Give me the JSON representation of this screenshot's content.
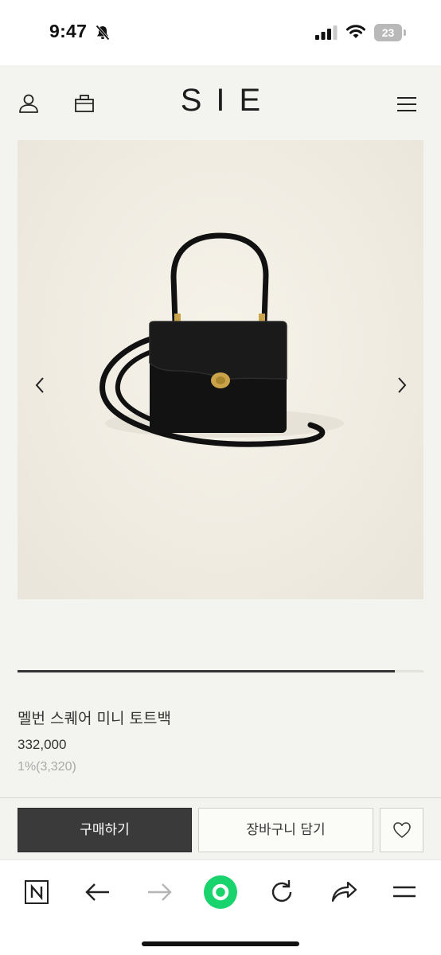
{
  "status_bar": {
    "time": "9:47",
    "battery_level": "23",
    "icons": [
      "bell-slash-icon",
      "cellular-signal-icon",
      "wifi-icon",
      "battery-icon"
    ]
  },
  "header": {
    "logo": "SIE",
    "icons": [
      "user-icon",
      "shopping-bag-icon",
      "hamburger-menu-icon"
    ]
  },
  "gallery": {
    "image_alt": "black leather square mini tote bag with top handle and shoulder strap",
    "prev_icon": "chevron-left-icon",
    "next_icon": "chevron-right-icon",
    "progress": 0.93
  },
  "product": {
    "name": "멜번 스퀘어 미니 토트백",
    "price": "332,000",
    "points": "1%(3,320)"
  },
  "actions": {
    "buy_label": "구매하기",
    "cart_label": "장바구니 담기",
    "wish_icon": "heart-icon"
  },
  "browser_toolbar": {
    "icons": [
      "naver-n-icon",
      "back-arrow-icon",
      "forward-arrow-icon",
      "green-circle-home-icon",
      "reload-icon",
      "share-icon",
      "menu-lines-icon"
    ]
  },
  "colors": {
    "page_bg": "#f3f3ef",
    "buy_button_bg": "#3a3a3a",
    "accent_green": "#19d36c"
  }
}
